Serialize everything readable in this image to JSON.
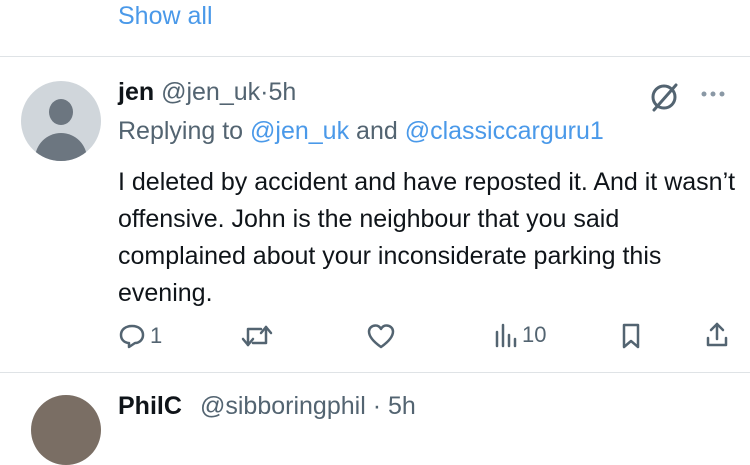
{
  "top": {
    "show_all_label": "Show all"
  },
  "tweet": {
    "name": "jen",
    "handle": "@jen_uk",
    "dot": "·",
    "time": "5h",
    "replying_prefix": "Replying to ",
    "replying_user1": "@jen_uk",
    "replying_and": " and ",
    "replying_user2": "@classiccarguru1",
    "text": "I deleted by accident and have reposted it. And it wasn’t offensive. John is the neighbour that you said complained about your inconsiderate parking this evening.",
    "replies": "1",
    "views": "10"
  },
  "next_tweet": {
    "name": "PhilC",
    "handle": "@sibboringphil · 5h"
  },
  "icons": {
    "grok": "slashed-circle-icon",
    "more": "more-icon",
    "reply": "reply-icon",
    "retweet": "retweet-icon",
    "like": "heart-icon",
    "views": "views-icon",
    "bookmark": "bookmark-icon",
    "share": "share-icon"
  },
  "colors": {
    "link": "#4a99e9",
    "secondary_text": "#536471",
    "primary_text": "#0f1419"
  }
}
